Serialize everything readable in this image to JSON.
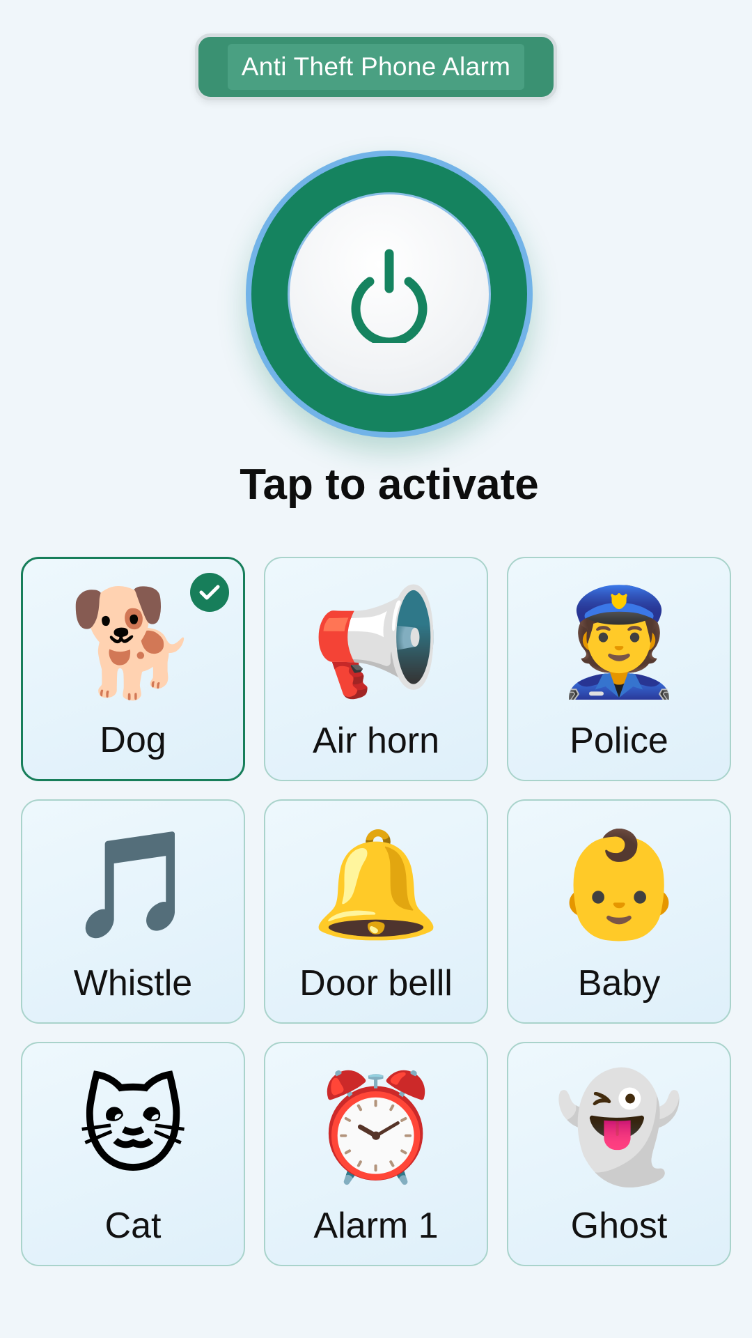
{
  "header": {
    "title": "Anti Theft Phone Alarm"
  },
  "power_button": {
    "icon": "power-icon",
    "accent": "#15835f",
    "ring": "#72b3e8"
  },
  "prompt": "Tap to activate",
  "sounds": [
    {
      "id": "dog",
      "label": "Dog",
      "emoji": "🐕",
      "selected": true
    },
    {
      "id": "air-horn",
      "label": "Air horn",
      "emoji": "📢",
      "selected": false
    },
    {
      "id": "police",
      "label": "Police",
      "emoji": "👮",
      "selected": false
    },
    {
      "id": "whistle",
      "label": "Whistle",
      "emoji": "🎵",
      "selected": false
    },
    {
      "id": "door-bell",
      "label": "Door belll",
      "emoji": "🔔",
      "selected": false
    },
    {
      "id": "baby",
      "label": "Baby",
      "emoji": "👶",
      "selected": false
    },
    {
      "id": "cat",
      "label": "Cat",
      "emoji": "🐱",
      "selected": false
    },
    {
      "id": "alarm-1",
      "label": "Alarm 1",
      "emoji": "⏰",
      "selected": false
    },
    {
      "id": "ghost",
      "label": "Ghost",
      "emoji": "👻",
      "selected": false
    }
  ],
  "colors": {
    "background": "#f0f6fa",
    "selected_border": "#177e5a",
    "card_border": "#a9d3cb"
  }
}
